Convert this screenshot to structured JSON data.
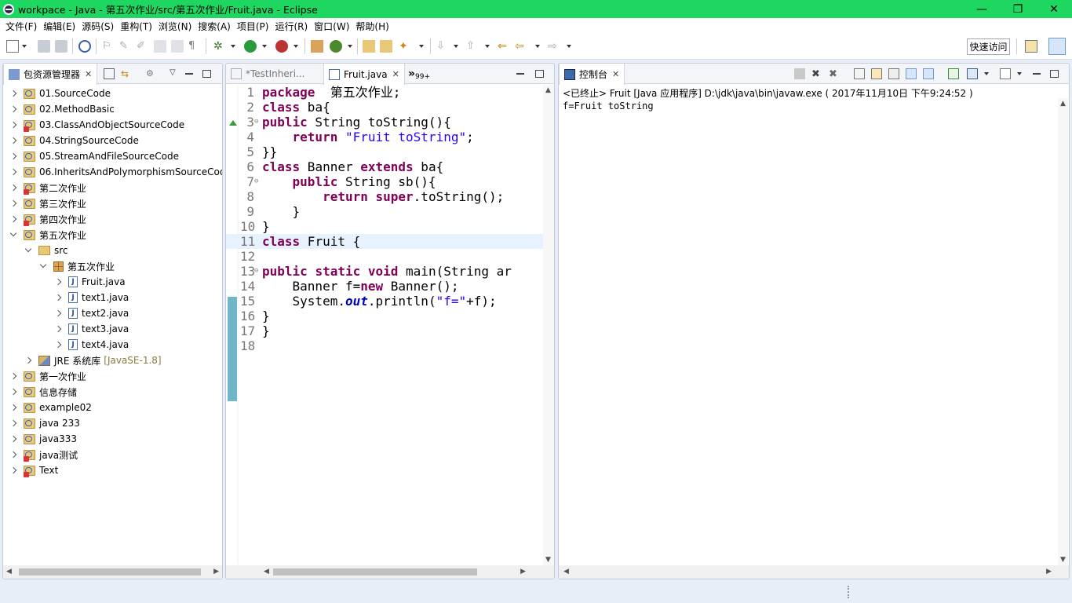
{
  "window": {
    "title": "workpace  -  Java  -  第五次作业/src/第五次作业/Fruit.java  -  Eclipse",
    "minimize": "—",
    "maximize": "❐",
    "close": "✕"
  },
  "menu": [
    "文件(F)",
    "编辑(E)",
    "源码(S)",
    "重构(T)",
    "浏览(N)",
    "搜索(A)",
    "项目(P)",
    "运行(R)",
    "窗口(W)",
    "帮助(H)"
  ],
  "toolbar": {
    "quick_access": "快速访问"
  },
  "explorer": {
    "tab_label": "包资源管理器",
    "items": [
      {
        "label": "01.SourceCode"
      },
      {
        "label": "02.MethodBasic"
      },
      {
        "label": "03.ClassAndObjectSourceCode"
      },
      {
        "label": "04.StringSourceCode"
      },
      {
        "label": "05.StreamAndFileSourceCode"
      },
      {
        "label": "06.InheritsAndPolymorphismSourceCod"
      },
      {
        "label": "第二次作业"
      },
      {
        "label": "第三次作业"
      },
      {
        "label": "第四次作业"
      },
      {
        "label": "第五次作业"
      },
      {
        "label": "src"
      },
      {
        "label": "第五次作业"
      },
      {
        "label": "Fruit.java"
      },
      {
        "label": "text1.java"
      },
      {
        "label": "text2.java"
      },
      {
        "label": "text3.java"
      },
      {
        "label": "text4.java"
      },
      {
        "label": "JRE 系统库",
        "extra": "[JavaSE-1.8]"
      },
      {
        "label": "第一次作业"
      },
      {
        "label": "信息存储"
      },
      {
        "label": "example02"
      },
      {
        "label": "java 233"
      },
      {
        "label": "java333"
      },
      {
        "label": "java测试"
      },
      {
        "label": "Text"
      }
    ]
  },
  "editor": {
    "tabs": [
      {
        "label": "*TestInheri..."
      },
      {
        "label": "Fruit.java"
      },
      {
        "label": "»",
        "extra": "99+"
      }
    ],
    "lines": [
      {
        "n": "1",
        "parts": [
          [
            "kw",
            "package"
          ],
          [
            "",
            "  第五次作业;"
          ]
        ]
      },
      {
        "n": "2",
        "parts": [
          [
            "kw",
            "class"
          ],
          [
            "",
            " ba{"
          ]
        ]
      },
      {
        "n": "3",
        "parts": [
          [
            "kw",
            "public"
          ],
          [
            "",
            " String toString(){"
          ]
        ]
      },
      {
        "n": "4",
        "parts": [
          [
            "",
            "    "
          ],
          [
            "kw",
            "return"
          ],
          [
            "",
            " "
          ],
          [
            "str",
            "\"Fruit toString\""
          ],
          [
            "",
            ";"
          ]
        ]
      },
      {
        "n": "5",
        "parts": [
          [
            "",
            "}}"
          ]
        ]
      },
      {
        "n": "6",
        "parts": [
          [
            "kw",
            "class"
          ],
          [
            "",
            " Banner "
          ],
          [
            "kw",
            "extends"
          ],
          [
            "",
            " ba{"
          ]
        ]
      },
      {
        "n": "7",
        "parts": [
          [
            "",
            "    "
          ],
          [
            "kw",
            "public"
          ],
          [
            "",
            " String sb(){"
          ]
        ]
      },
      {
        "n": "8",
        "parts": [
          [
            "",
            "        "
          ],
          [
            "kw",
            "return"
          ],
          [
            "",
            " "
          ],
          [
            "kw",
            "super"
          ],
          [
            "",
            ".toString();"
          ]
        ]
      },
      {
        "n": "9",
        "parts": [
          [
            "",
            "    }"
          ]
        ]
      },
      {
        "n": "10",
        "parts": [
          [
            "",
            "}"
          ]
        ]
      },
      {
        "n": "11",
        "parts": [
          [
            "kw",
            "class"
          ],
          [
            "",
            " Fruit {"
          ]
        ]
      },
      {
        "n": "12",
        "parts": [
          [
            "",
            ""
          ]
        ]
      },
      {
        "n": "13",
        "parts": [
          [
            "kw",
            "public"
          ],
          [
            "",
            " "
          ],
          [
            "kw",
            "static"
          ],
          [
            "",
            " "
          ],
          [
            "kw",
            "void"
          ],
          [
            "",
            " main(String ar"
          ]
        ]
      },
      {
        "n": "14",
        "parts": [
          [
            "",
            "    Banner f="
          ],
          [
            "kw",
            "new"
          ],
          [
            "",
            " Banner();"
          ]
        ]
      },
      {
        "n": "15",
        "parts": [
          [
            "",
            "    System."
          ],
          [
            "fld",
            "out"
          ],
          [
            "",
            ".println("
          ],
          [
            "str",
            "\"f=\""
          ],
          [
            "",
            "+f);"
          ]
        ]
      },
      {
        "n": "16",
        "parts": [
          [
            "",
            "}"
          ]
        ]
      },
      {
        "n": "17",
        "parts": [
          [
            "",
            "}"
          ]
        ]
      },
      {
        "n": "18",
        "parts": [
          [
            "",
            ""
          ]
        ]
      }
    ]
  },
  "console": {
    "tab_label": "控制台",
    "status": "<已终止> Fruit [Java 应用程序] D:\\jdk\\java\\bin\\javaw.exe ( 2017年11月10日 下午9:24:52 )",
    "output": "f=Fruit toString"
  },
  "colors": {
    "titlebar": "#1ed760",
    "keyword": "#7f0055",
    "string": "#2a00ff",
    "field": "#0000c0"
  }
}
